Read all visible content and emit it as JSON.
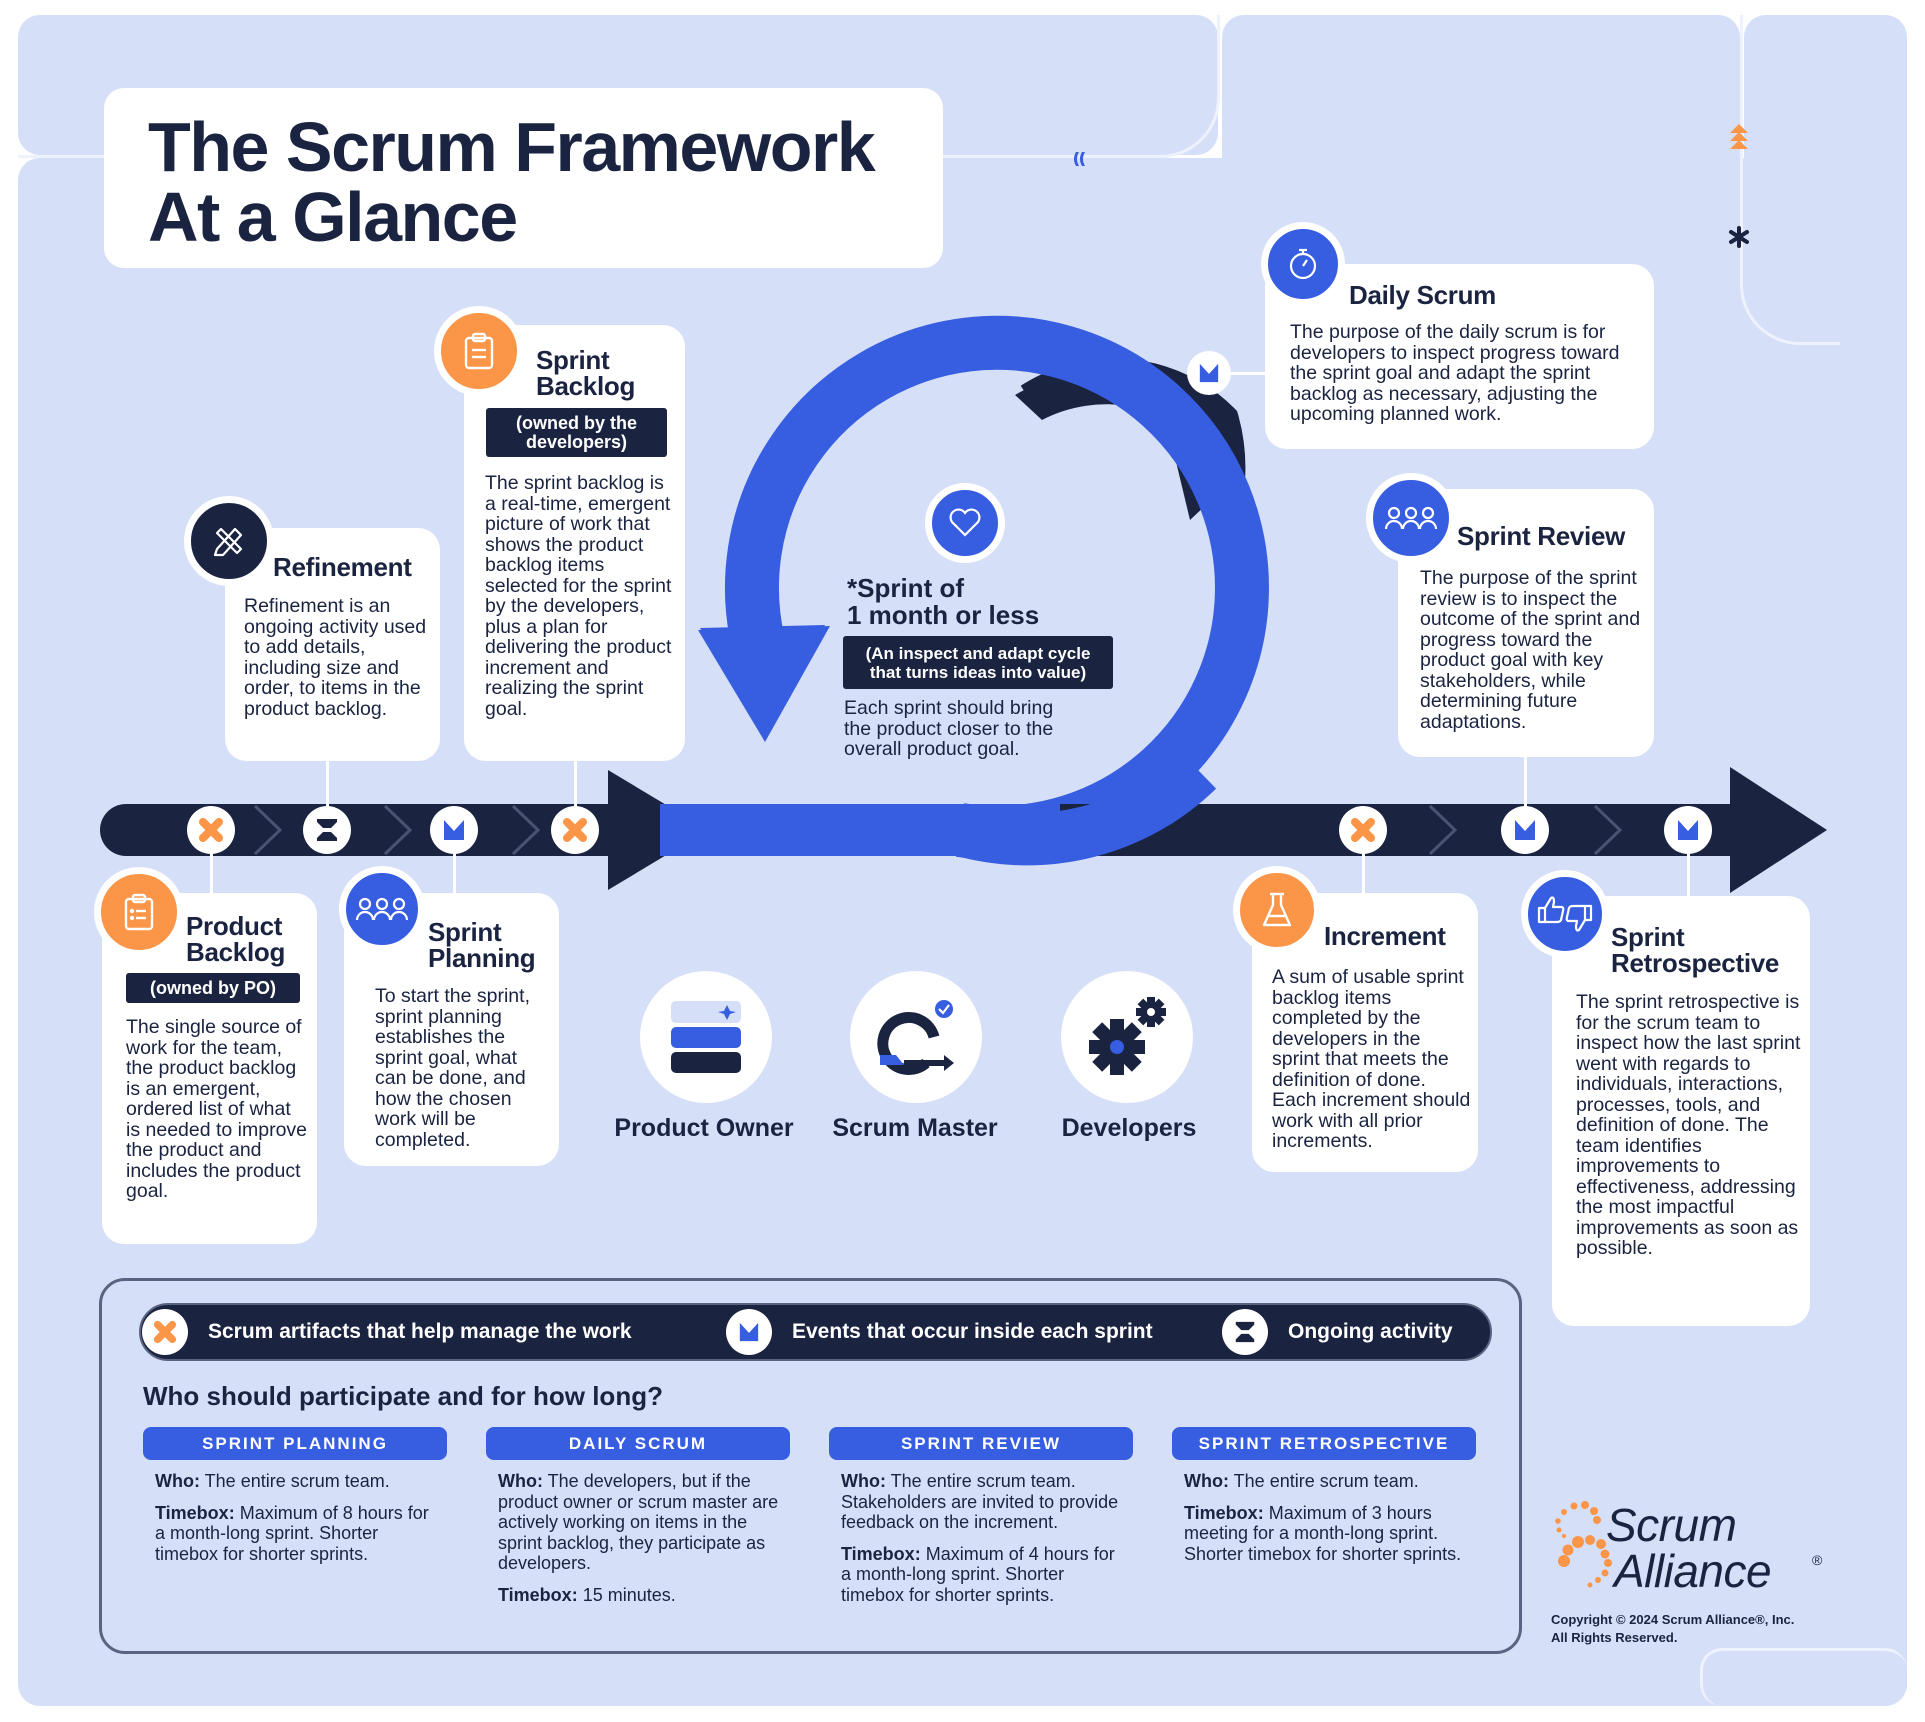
{
  "title": {
    "line1": "The Scrum Framework",
    "line2": "At a Glance"
  },
  "colors": {
    "background": "#d6dff8",
    "navy": "#1a2340",
    "blue": "#375ee0",
    "orange": "#fb9548",
    "white": "#ffffff"
  },
  "cards": {
    "refinement": {
      "title": "Refinement",
      "icon": "pencil-ruler-icon",
      "body": "Refinement is an ongoing activity used to add details, including size and order, to items in the product backlog."
    },
    "sprint_backlog": {
      "title_line1": "Sprint",
      "title_line2": "Backlog",
      "icon": "clipboard-icon",
      "owner": "(owned by the developers)",
      "body": "The sprint backlog is a real-time, emergent picture of work that shows the product backlog items selected for the sprint by the developers, plus a plan for delivering the product increment and realizing the sprint goal."
    },
    "daily_scrum": {
      "title": "Daily Scrum",
      "icon": "stopwatch-icon",
      "body": "The purpose of the daily scrum is for developers to inspect progress toward the sprint goal and adapt the sprint backlog as necessary, adjusting the upcoming planned work."
    },
    "sprint_review": {
      "title": "Sprint Review",
      "icon": "people-group-icon",
      "body": "The purpose of the sprint review is to inspect the outcome of the sprint and progress toward the product goal with key stakeholders, while determining future adaptations."
    },
    "product_backlog": {
      "title_line1": "Product",
      "title_line2": "Backlog",
      "icon": "clipboard-icon",
      "owner": "(owned by PO)",
      "body": "The single source of work for the team, the product backlog is an emergent, ordered list of what is needed to improve the product and includes the product goal."
    },
    "sprint_planning": {
      "title_line1": "Sprint",
      "title_line2": "Planning",
      "icon": "people-group-icon",
      "body": "To start the sprint, sprint planning establishes the sprint goal, what can be done, and how the chosen work will be completed."
    },
    "increment": {
      "title": "Increment",
      "icon": "flask-icon",
      "body": "A sum of usable sprint backlog items completed by the developers in the sprint that meets the definition of done. Each increment should work with all prior increments."
    },
    "sprint_retrospective": {
      "title_line1": "Sprint",
      "title_line2": "Retrospective",
      "icon": "thumbs-up-down-icon",
      "body": "The sprint retrospective is for the scrum team to inspect how the last sprint went with regards to individuals, interactions, processes, tools, and definition of done. The team identifies improvements to effectiveness, addressing the most impactful improvements as soon as possible."
    }
  },
  "sprint_cycle": {
    "icon": "heart-icon",
    "title_line1": "*Sprint of",
    "title_line2": "1 month or less",
    "subtitle": "(An inspect and adapt cycle that turns ideas into value)",
    "body": "Each sprint should bring the product closer to the overall product goal."
  },
  "timeline": {
    "markers": [
      {
        "type": "artifact",
        "icon": "cross-icon",
        "for": "Product Backlog"
      },
      {
        "type": "ongoing",
        "icon": "hourglass-icon",
        "for": "Refinement"
      },
      {
        "type": "event",
        "icon": "event-flag-icon",
        "for": "Sprint Planning"
      },
      {
        "type": "artifact",
        "icon": "cross-icon",
        "for": "Sprint Backlog"
      },
      {
        "type": "artifact",
        "icon": "cross-icon",
        "for": "Increment"
      },
      {
        "type": "event",
        "icon": "event-flag-icon",
        "for": "Sprint Review"
      },
      {
        "type": "event",
        "icon": "event-flag-icon",
        "for": "Sprint Retrospective"
      }
    ],
    "daily_marker": {
      "type": "event",
      "icon": "event-flag-icon",
      "for": "Daily Scrum"
    }
  },
  "roles": [
    {
      "label": "Product Owner",
      "icon": "stacked-layers-icon"
    },
    {
      "label": "Scrum Master",
      "icon": "cycle-check-icon"
    },
    {
      "label": "Developers",
      "icon": "gears-icon"
    }
  ],
  "legend": [
    {
      "icon": "cross-icon",
      "label": "Scrum artifacts that help manage the work"
    },
    {
      "icon": "event-flag-icon",
      "label": "Events that occur inside each sprint"
    },
    {
      "icon": "hourglass-icon",
      "label": "Ongoing activity"
    }
  ],
  "participation": {
    "heading": "Who should participate and for how long?",
    "who_label": "Who:",
    "timebox_label": "Timebox:",
    "columns": [
      {
        "header": "SPRINT PLANNING",
        "who": "The entire scrum team.",
        "timebox": "Maximum of 8 hours for a month-long sprint. Shorter timebox for shorter sprints."
      },
      {
        "header": "DAILY SCRUM",
        "who": "The developers, but if the product owner or scrum master are actively working on items in the sprint backlog, they participate as developers.",
        "timebox": "15 minutes."
      },
      {
        "header": "SPRINT REVIEW",
        "who": "The entire scrum team. Stakeholders are invited to provide feedback on the increment.",
        "timebox": "Maximum of 4 hours for a month-long sprint. Shorter timebox for shorter sprints."
      },
      {
        "header": "SPRINT RETROSPECTIVE",
        "who": "The entire scrum team.",
        "timebox": "Maximum of 3 hours meeting for a month-long sprint. Shorter timebox for shorter sprints."
      }
    ]
  },
  "brand": {
    "logo_line1": "Scrum",
    "logo_line2": "Alliance",
    "registered": "®",
    "copyright_line1": "Copyright © 2024 Scrum Alliance®, Inc.",
    "copyright_line2": "All Rights Reserved."
  }
}
